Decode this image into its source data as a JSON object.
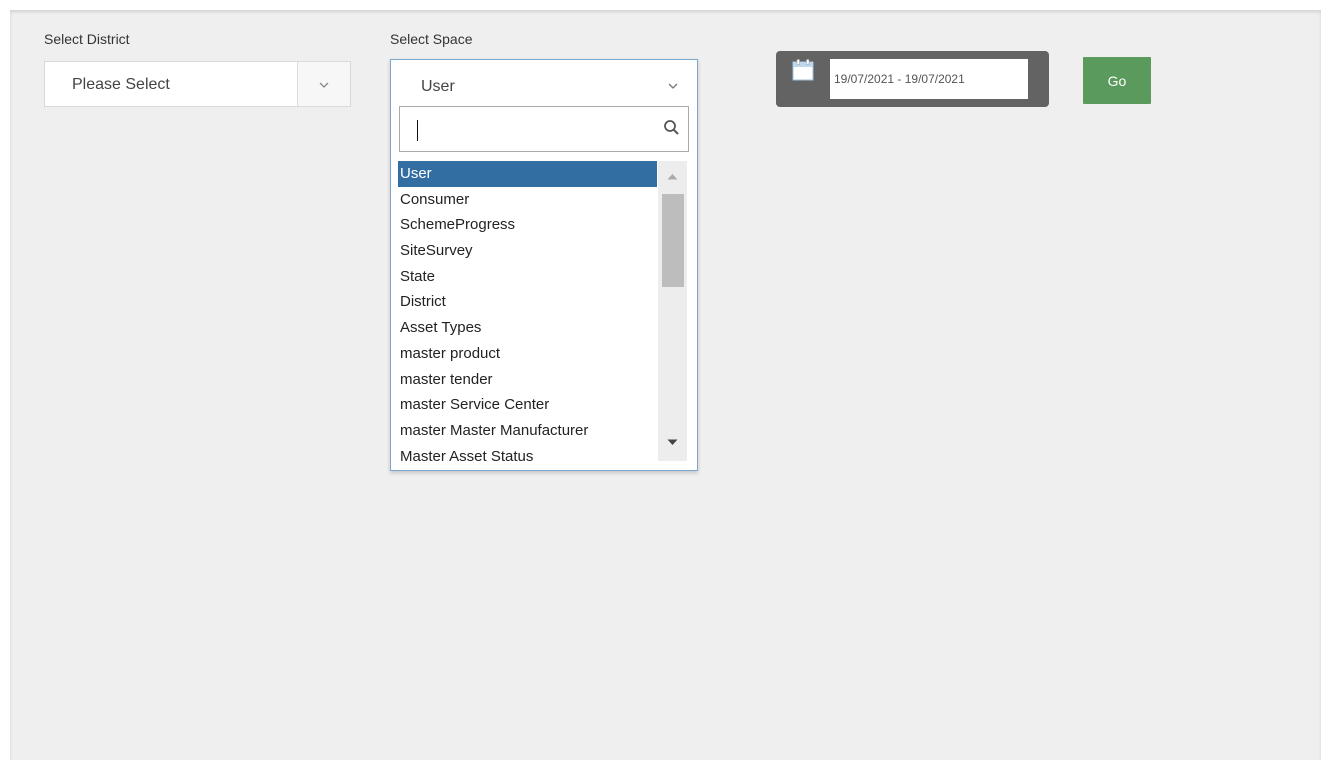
{
  "filters": {
    "district": {
      "label": "Select District",
      "value": "Please Select"
    },
    "space": {
      "label": "Select Space",
      "value": "User",
      "search_value": "",
      "options": [
        "User",
        "Consumer",
        "SchemeProgress",
        "SiteSurvey",
        "State",
        "District",
        "Asset Types",
        "master product",
        "master tender",
        "master Service Center",
        "master Master Manufacturer",
        "Master Asset Status"
      ],
      "selected_index": 0
    },
    "date_range": {
      "value": "19/07/2021 - 19/07/2021"
    },
    "go_label": "Go"
  },
  "colors": {
    "selected_option_bg": "#336ea3",
    "go_button_bg": "#5a9a5c",
    "date_container_bg": "#636363"
  },
  "icons": {
    "district_dropdown": "chevron-down-icon",
    "space_dropdown": "chevron-down-icon",
    "search": "search-icon",
    "calendar": "calendar-icon",
    "scroll_up": "scroll-up-arrow-icon",
    "scroll_down": "scroll-down-arrow-icon"
  }
}
